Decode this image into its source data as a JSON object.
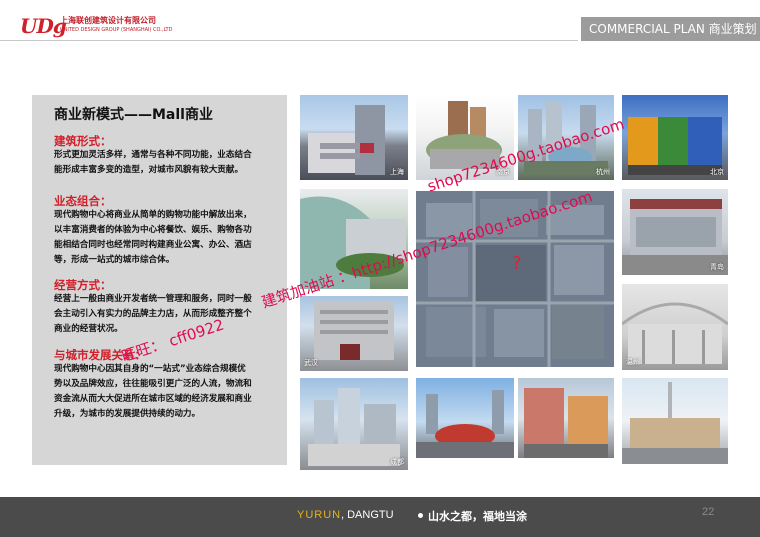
{
  "header": {
    "logo_mark": "UDg",
    "company_cn": "上海联创建筑设计有限公司",
    "company_en": "UNITED DESIGN GROUP (SHANGHAI) CO.,LTD",
    "section_tab": "COMMERCIAL PLAN 商业策划"
  },
  "panel": {
    "title": "商业新模式——Mall商业",
    "sections": [
      {
        "title": "建筑形式：",
        "lines": [
          "形式更加灵活多样，通常与各种不同功能，业态结合",
          "能形成丰富多变的造型，对城市风貌有较大贡献。"
        ]
      },
      {
        "title": "业态组合：",
        "lines": [
          "现代购物中心将商业从简单的购物功能中解放出来，",
          "以丰富消费者的体验为中心将餐饮、娱乐、购物各功",
          "能相结合同时也经常同时构建商业公寓、办公、酒店",
          "等，形成一站式的城市综合体。"
        ]
      },
      {
        "title": "经营方式：",
        "lines": [
          "经营上一般由商业开发者统一管理和服务，同时一般",
          "会主动引入有实力的品牌主力店，从而形成整齐整个",
          "商业的经营状况。"
        ]
      },
      {
        "title": "与城市发展关系：",
        "lines": [
          "现代购物中心因其自身的“一站式”业态综合规模优",
          "势以及品牌效应，往往能吸引更广泛的人流，物流和",
          "资金流从而大大促进所在城市区域的经济发展和商业",
          "升级，为城市的发展提供持续的动力。"
        ]
      }
    ]
  },
  "photos": {
    "labels": [
      "上海",
      "南京",
      "杭州",
      "北京",
      "青岛",
      "武汉",
      "温州",
      "成都"
    ],
    "aerial_mark": "?"
  },
  "watermark": {
    "line1": "shop7234600g.taobao.com",
    "line2": "建筑加油站 ：http://shop7234600g.taobao.com",
    "line3": "旺旺： cff0922"
  },
  "footer": {
    "yurun": "YURUN",
    "dangtu": " , DANGTU",
    "slogan": "山水之都，福地当涂",
    "page": "22"
  },
  "colors": {
    "accent_red": "#d0202a",
    "panel_gray": "#d6d6d6",
    "footer_gray": "#4b4b4b",
    "footer_gold": "#e6b21a",
    "watermark_pink": "#e00a50"
  }
}
